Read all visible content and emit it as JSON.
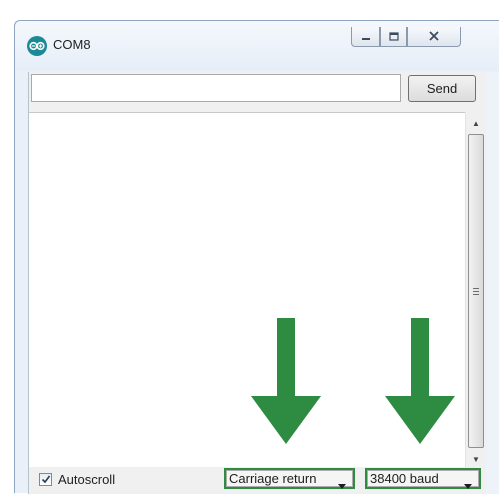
{
  "window": {
    "title": "COM8",
    "icon": "arduino-infinity-icon",
    "controls": [
      "minimize-icon",
      "maximize-icon",
      "close-icon"
    ]
  },
  "toolbar": {
    "input_value": "",
    "send_label": "Send"
  },
  "output": {
    "text": ""
  },
  "footer": {
    "autoscroll_label": "Autoscroll",
    "autoscroll_checked": true,
    "line_ending": "Carriage return",
    "baud_rate": "38400 baud"
  },
  "annotations": {
    "arrow_color": "#2e8b42",
    "highlight_color": "#2e8b42",
    "arrow_icons": [
      "down-arrow-icon",
      "down-arrow-icon"
    ]
  }
}
